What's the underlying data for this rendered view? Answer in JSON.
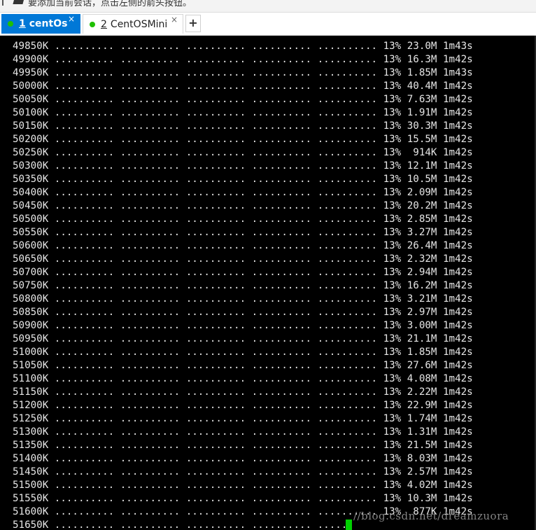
{
  "tabs": [
    {
      "index": "1",
      "label": "centOs",
      "active": true,
      "close": "×",
      "status_color": "#1fc000"
    },
    {
      "index": "2",
      "label": "CentOSMini",
      "active": false,
      "close": "×",
      "status_color": "#1fc000"
    }
  ],
  "add_tab_label": "+",
  "infobar_text": "要添加当前会话，点击左侧的箭头按钮。",
  "terminal": {
    "lines": [
      "49850K .......... .......... .......... .......... .......... 13% 23.0M 1m43s",
      "49900K .......... .......... .......... .......... .......... 13% 16.3M 1m42s",
      "49950K .......... .......... .......... .......... .......... 13% 1.85M 1m43s",
      "50000K .......... .......... .......... .......... .......... 13% 40.4M 1m42s",
      "50050K .......... .......... .......... .......... .......... 13% 7.63M 1m42s",
      "50100K .......... .......... .......... .......... .......... 13% 1.91M 1m42s",
      "50150K .......... .......... .......... .......... .......... 13% 30.3M 1m42s",
      "50200K .......... .......... .......... .......... .......... 13% 15.5M 1m42s",
      "50250K .......... .......... .......... .......... .......... 13%  914K 1m42s",
      "50300K .......... .......... .......... .......... .......... 13% 12.1M 1m42s",
      "50350K .......... .......... .......... .......... .......... 13% 10.5M 1m42s",
      "50400K .......... .......... .......... .......... .......... 13% 2.09M 1m42s",
      "50450K .......... .......... .......... .......... .......... 13% 20.2M 1m42s",
      "50500K .......... .......... .......... .......... .......... 13% 2.85M 1m42s",
      "50550K .......... .......... .......... .......... .......... 13% 3.27M 1m42s",
      "50600K .......... .......... .......... .......... .......... 13% 26.4M 1m42s",
      "50650K .......... .......... .......... .......... .......... 13% 2.32M 1m42s",
      "50700K .......... .......... .......... .......... .......... 13% 2.94M 1m42s",
      "50750K .......... .......... .......... .......... .......... 13% 16.2M 1m42s",
      "50800K .......... .......... .......... .......... .......... 13% 3.21M 1m42s",
      "50850K .......... .......... .......... .......... .......... 13% 2.97M 1m42s",
      "50900K .......... .......... .......... .......... .......... 13% 3.00M 1m42s",
      "50950K .......... .......... .......... .......... .......... 13% 21.1M 1m42s",
      "51000K .......... .......... .......... .......... .......... 13% 1.85M 1m42s",
      "51050K .......... .......... .......... .......... .......... 13% 27.6M 1m42s",
      "51100K .......... .......... .......... .......... .......... 13% 4.08M 1m42s",
      "51150K .......... .......... .......... .......... .......... 13% 2.22M 1m42s",
      "51200K .......... .......... .......... .......... .......... 13% 22.9M 1m42s",
      "51250K .......... .......... .......... .......... .......... 13% 1.74M 1m42s",
      "51300K .......... .......... .......... .......... .......... 13% 1.31M 1m42s",
      "51350K .......... .......... .......... .......... .......... 13% 21.5M 1m42s",
      "51400K .......... .......... .......... .......... .......... 13% 8.03M 1m42s",
      "51450K .......... .......... .......... .......... .......... 13% 2.57M 1m42s",
      "51500K .......... .......... .......... .......... .......... 13% 4.02M 1m42s",
      "51550K .......... .......... .......... .......... .......... 13% 10.3M 1m42s",
      "51600K .......... .......... .......... .......... .......... 13%  877K 1m42s",
      "51650K .......... .......... .......... .......... ......"
    ],
    "text_color": "#e6e6e6",
    "background": "#000000",
    "cursor_color": "#00d000"
  },
  "watermark": "//blog.csdn.net/dreamzuora",
  "icons": {
    "pin": "pin-icon",
    "flag": "arrow-flag-icon",
    "status": "status-dot-icon",
    "close": "close-icon",
    "add": "plus-icon"
  }
}
